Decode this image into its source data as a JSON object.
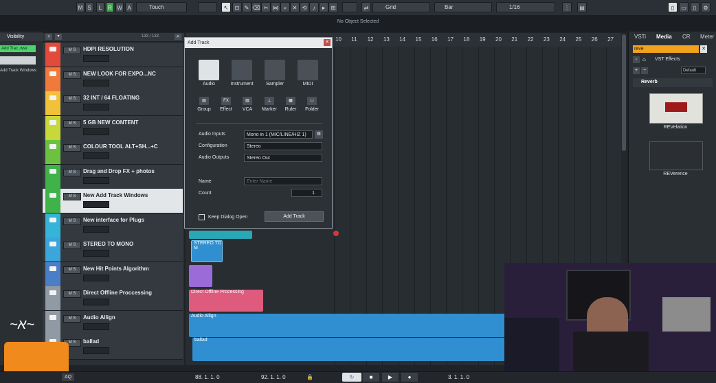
{
  "toolbar": {
    "buttons": [
      "M",
      "S",
      "L",
      "R",
      "W",
      "A"
    ],
    "automation_mode": "Touch",
    "snap_mode": "Grid",
    "grid_type": "Bar",
    "quantize": "1/16"
  },
  "status": {
    "selection": "No Object Selected"
  },
  "inspector": {
    "visibility_tab": "Visibility",
    "track_chip": "Add Trac..wsx",
    "track_line": "Add Track Windows"
  },
  "tracklist": {
    "count_label": "133 / 133",
    "tracks": [
      {
        "name": "HDPI RESOLUTION",
        "color": "#e24b3b"
      },
      {
        "name": "NEW LOOK FOR EXPO...NC",
        "color": "#f07a3a"
      },
      {
        "name": "32 INT / 64 FLOATING",
        "color": "#f2c13a"
      },
      {
        "name": "5 GB NEW CONTENT",
        "color": "#c7d83b"
      },
      {
        "name": "COLOUR TOOL ALT+SH...+C",
        "color": "#6cc23e"
      },
      {
        "name": "Drag and Drop FX + photos",
        "color": "#3fb24a"
      },
      {
        "name": "New Add Track Windows",
        "color": "#3fb24a"
      },
      {
        "name": "New interface for Plugs",
        "color": "#35b3d8"
      },
      {
        "name": "STEREO TO MONO",
        "color": "#3aa6dc"
      },
      {
        "name": "New Hit Points Algorithm",
        "color": "#4a7fc8"
      },
      {
        "name": "Direct Offline Proccessing",
        "color": "#8f9aa5"
      },
      {
        "name": "Audio Allign",
        "color": "#8f9aa5"
      },
      {
        "name": "ballad",
        "color": "#8f9aa5"
      }
    ]
  },
  "ruler": {
    "numbers": [
      "10",
      "11",
      "12",
      "13",
      "14",
      "15",
      "16",
      "17",
      "18",
      "19",
      "20",
      "21",
      "22",
      "23",
      "24",
      "25",
      "26",
      "27"
    ]
  },
  "events": {
    "stereo_to_mono": "STEREO TO M",
    "direct_offline": "Direct Offline Processing",
    "audio_allign": "Audio Allign",
    "ballad": "ballad"
  },
  "right_panel": {
    "tabs": [
      "VSTi",
      "Media",
      "CR",
      "Meter"
    ],
    "search_value": "reve",
    "path": "VST Effects",
    "sort": "Default",
    "category": "Reverb",
    "plugins": [
      "REVelation",
      "REVerence"
    ]
  },
  "dialog": {
    "title": "Add Track",
    "main_types": [
      "Audio",
      "Instrument",
      "Sampler",
      "MIDI"
    ],
    "other_types": [
      "Group",
      "Effect",
      "VCA",
      "Marker",
      "Ruler",
      "Folder"
    ],
    "audio_inputs_label": "Audio Inputs",
    "audio_inputs_value": "Mono in 1 (MIC/LINE/HIZ 1)",
    "configuration_label": "Configuration",
    "configuration_value": "Stereo",
    "audio_outputs_label": "Audio Outputs",
    "audio_outputs_value": "Stereo Out",
    "name_label": "Name",
    "name_placeholder": "Enter Name",
    "count_label": "Count",
    "count_value": "1",
    "keep_open_label": "Keep Dialog Open",
    "add_button": "Add Track"
  },
  "transport": {
    "left_locator": "88. 1. 1.   0",
    "right_locator": "92. 1. 1.   0",
    "position": "3. 1. 1.   0",
    "aq": "AQ"
  },
  "colors": {
    "audio_blue": "#2f8fd0",
    "pink": "#de5b7d",
    "purple": "#9b6bd8",
    "teal": "#2aa7b5"
  }
}
